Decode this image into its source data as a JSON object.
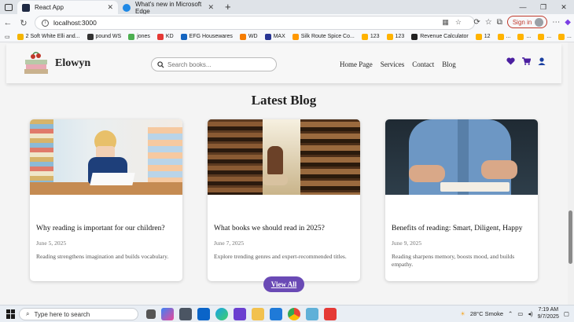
{
  "browser": {
    "tabs": [
      {
        "title": "React App",
        "active": true
      },
      {
        "title": "What's new in Microsoft Edge",
        "active": false
      }
    ],
    "new_tab": "+",
    "url": "localhost:3000",
    "sign_in": "Sign in",
    "bookmarks": [
      {
        "label": "2 Soft White Elli and...",
        "color": "#f4b400"
      },
      {
        "label": "pound WS",
        "color": "#333333"
      },
      {
        "label": "jones",
        "color": "#4caf50"
      },
      {
        "label": "KD",
        "color": "#e53935"
      },
      {
        "label": "EFG Housewares",
        "color": "#1565c0"
      },
      {
        "label": "WD",
        "color": "#f57c00"
      },
      {
        "label": "MAX",
        "color": "#283593"
      },
      {
        "label": "Silk Route Spice Co...",
        "color": "#ff9800"
      },
      {
        "label": "123",
        "color": "#ffb300"
      },
      {
        "label": "123",
        "color": "#ffb300"
      },
      {
        "label": "Revenue Calculator",
        "color": "#212121"
      },
      {
        "label": "12",
        "color": "#ffb300"
      },
      {
        "label": "...",
        "color": "#ffb300"
      },
      {
        "label": "...",
        "color": "#ffb300"
      },
      {
        "label": "...",
        "color": "#ffb300"
      },
      {
        "label": "...",
        "color": "#ffb300"
      }
    ]
  },
  "site": {
    "brand": "Elowyn",
    "search_placeholder": "Search books...",
    "nav": [
      "Home Page",
      "Services",
      "Contact",
      "Blog"
    ],
    "accent": "#4b1fa0"
  },
  "blog": {
    "heading": "Latest Blog",
    "posts": [
      {
        "title": "Why reading is important for our children?",
        "date": "June 5, 2025",
        "excerpt": "Reading strengthens imagination and builds vocabulary."
      },
      {
        "title": "What books we should read in 2025?",
        "date": "June 7, 2025",
        "excerpt": "Explore trending genres and expert-recommended titles."
      },
      {
        "title": "Benefits of reading: Smart, Diligent, Happy",
        "date": "June 9, 2025",
        "excerpt": "Reading sharpens memory, boosts mood, and builds empathy."
      }
    ],
    "view_all": "View All"
  },
  "taskbar": {
    "search_placeholder": "Type here to search",
    "weather": "28°C  Smoke",
    "time": "7:19 AM",
    "date": "9/7/2025"
  }
}
